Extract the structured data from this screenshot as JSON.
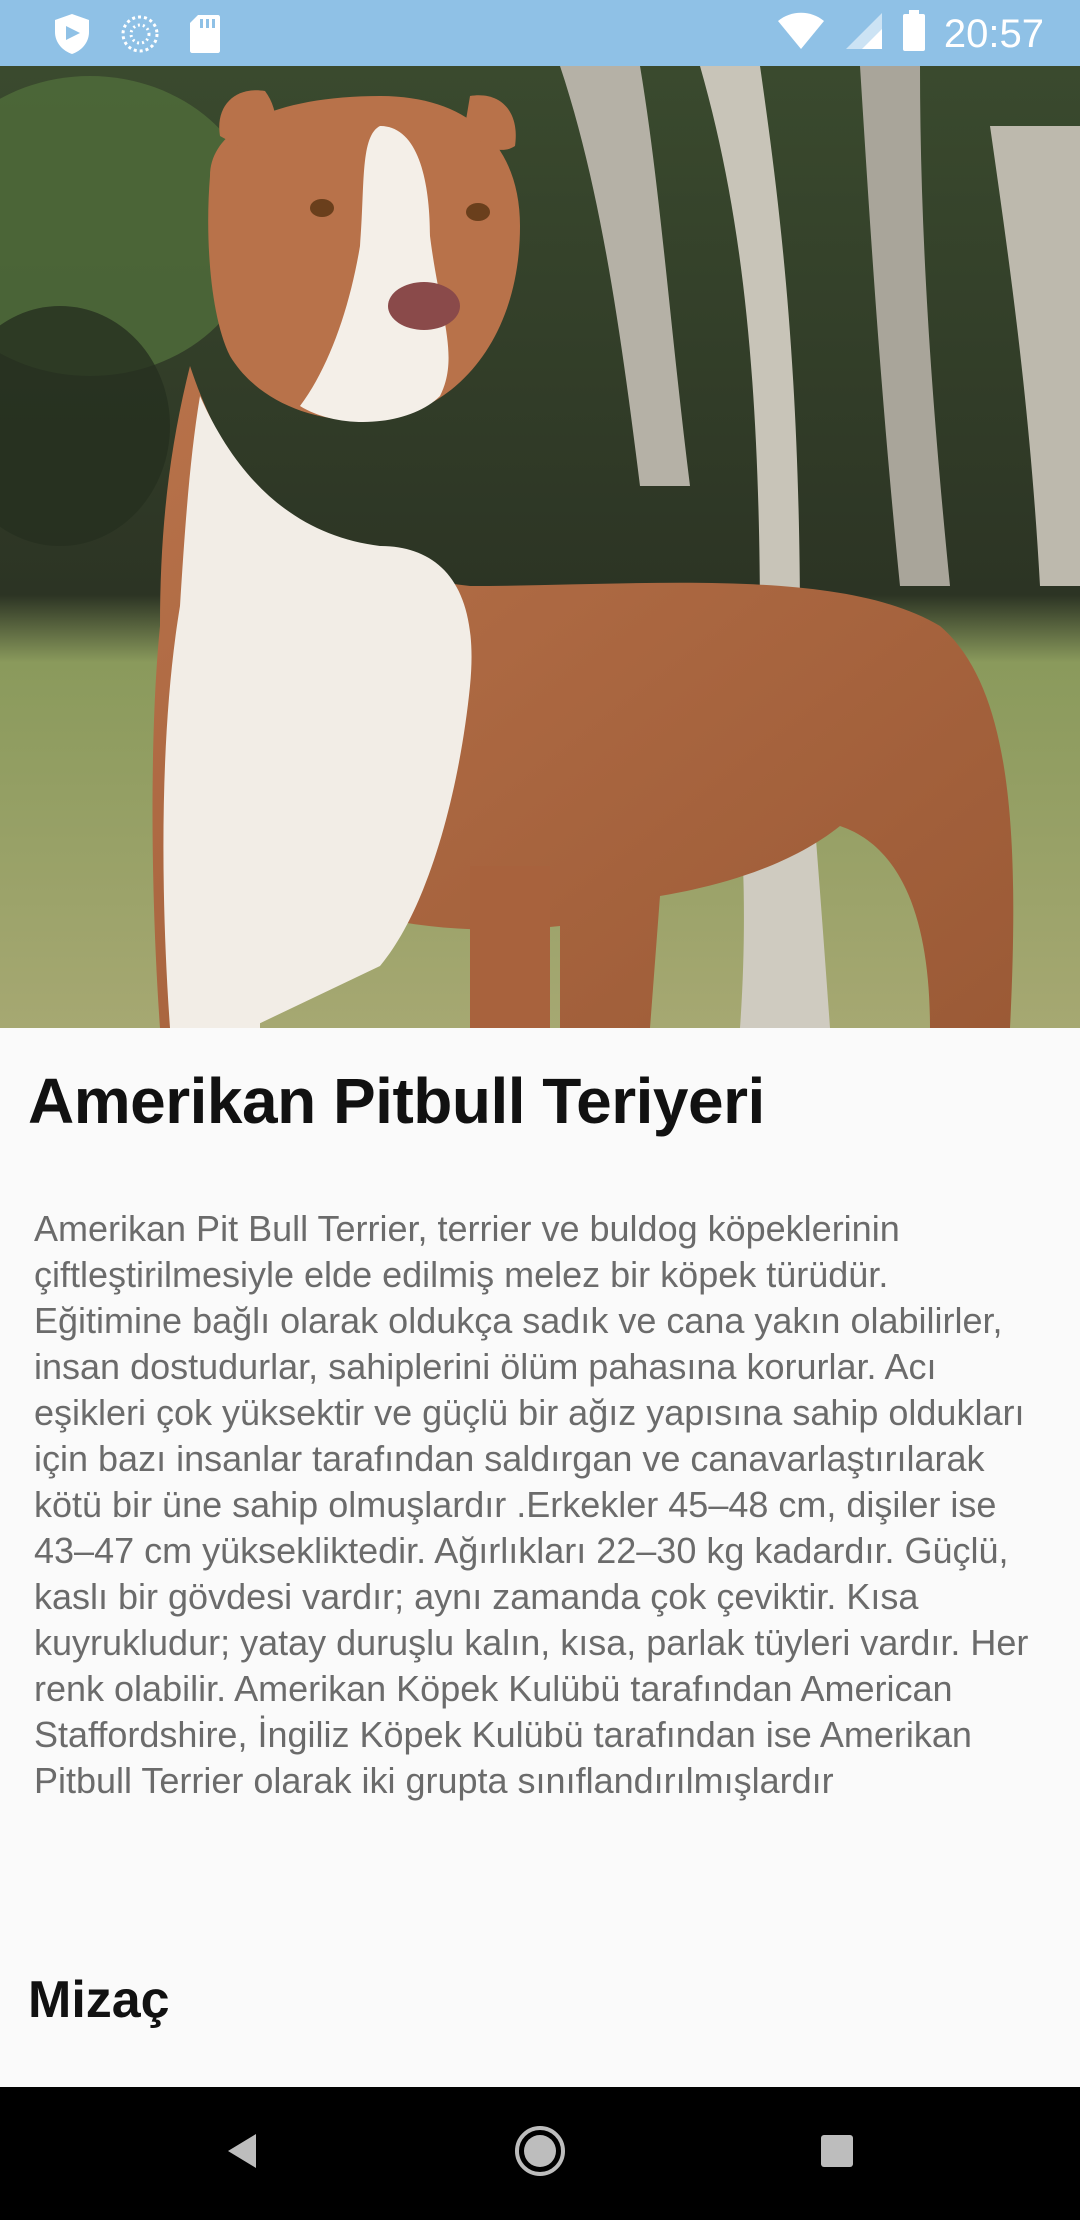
{
  "status_bar": {
    "time": "20:57",
    "left_icons": [
      "shield-icon",
      "sync-icon",
      "sd-card-icon"
    ],
    "right_icons": [
      "wifi-icon",
      "signal-icon",
      "battery-icon"
    ],
    "background": "#8fc1e6"
  },
  "hero": {
    "image": "american-pitbull-photo"
  },
  "breed": {
    "title": "Amerikan Pitbull Teriyeri",
    "description": "Amerikan Pit Bull Terrier, terrier ve buldog köpeklerinin çiftleştirilmesiyle elde edilmiş melez bir köpek türüdür. Eğitimine bağlı olarak oldukça sadık ve cana yakın olabilirler, insan dostudurlar, sahiplerini ölüm pahasına korurlar. Acı eşikleri çok yüksektir ve güçlü bir ağız yapısına sahip oldukları için bazı insanlar tarafından saldırgan ve canavarlaştırılarak kötü bir üne sahip olmuşlardır .Erkekler 45–48 cm, dişiler ise 43–47 cm yüksekliktedir. Ağırlıkları 22–30 kg kadardır. Güçlü, kaslı bir gövdesi vardır; aynı zamanda çok çeviktir. Kısa kuyrukludur; yatay duruşlu kalın, kısa, parlak tüyleri vardır. Her renk olabilir. Amerikan Köpek Kulübü tarafından American Staffordshire, İngiliz Köpek Kulübü tarafından ise Amerikan Pitbull Terrier olarak iki grupta sınıflandırılmışlardır",
    "section_heading": "Mizaç"
  },
  "nav_bar": {
    "buttons": [
      "back-icon",
      "home-icon",
      "recents-icon"
    ]
  }
}
